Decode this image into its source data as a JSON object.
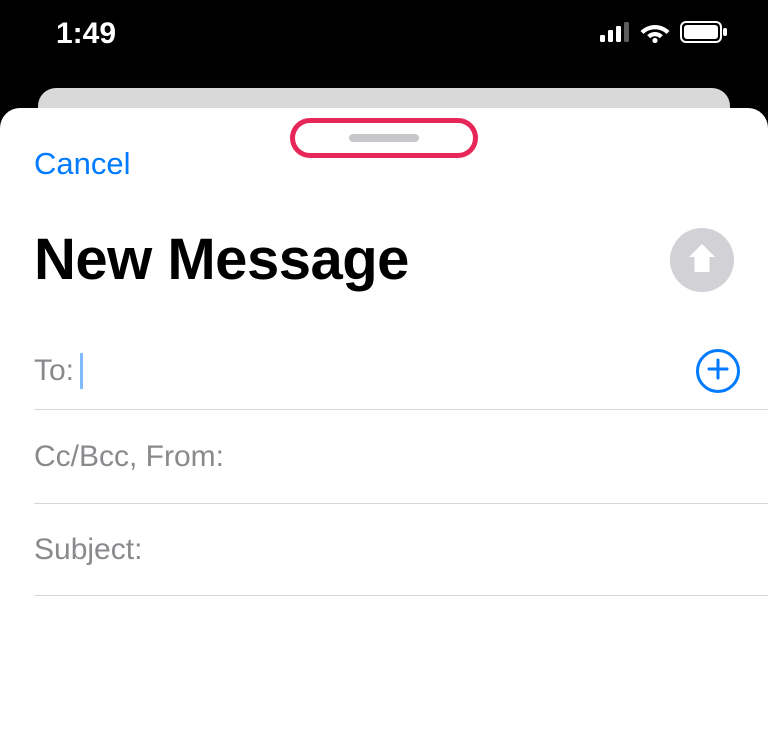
{
  "status": {
    "time": "1:49"
  },
  "compose": {
    "cancel_label": "Cancel",
    "title": "New Message",
    "fields": {
      "to_label": "To:",
      "to_value": "",
      "cc_label": "Cc/Bcc, From:",
      "cc_value": "",
      "subject_label": "Subject:",
      "subject_value": ""
    }
  },
  "annotation": {
    "highlight_target": "sheet-grabber"
  }
}
